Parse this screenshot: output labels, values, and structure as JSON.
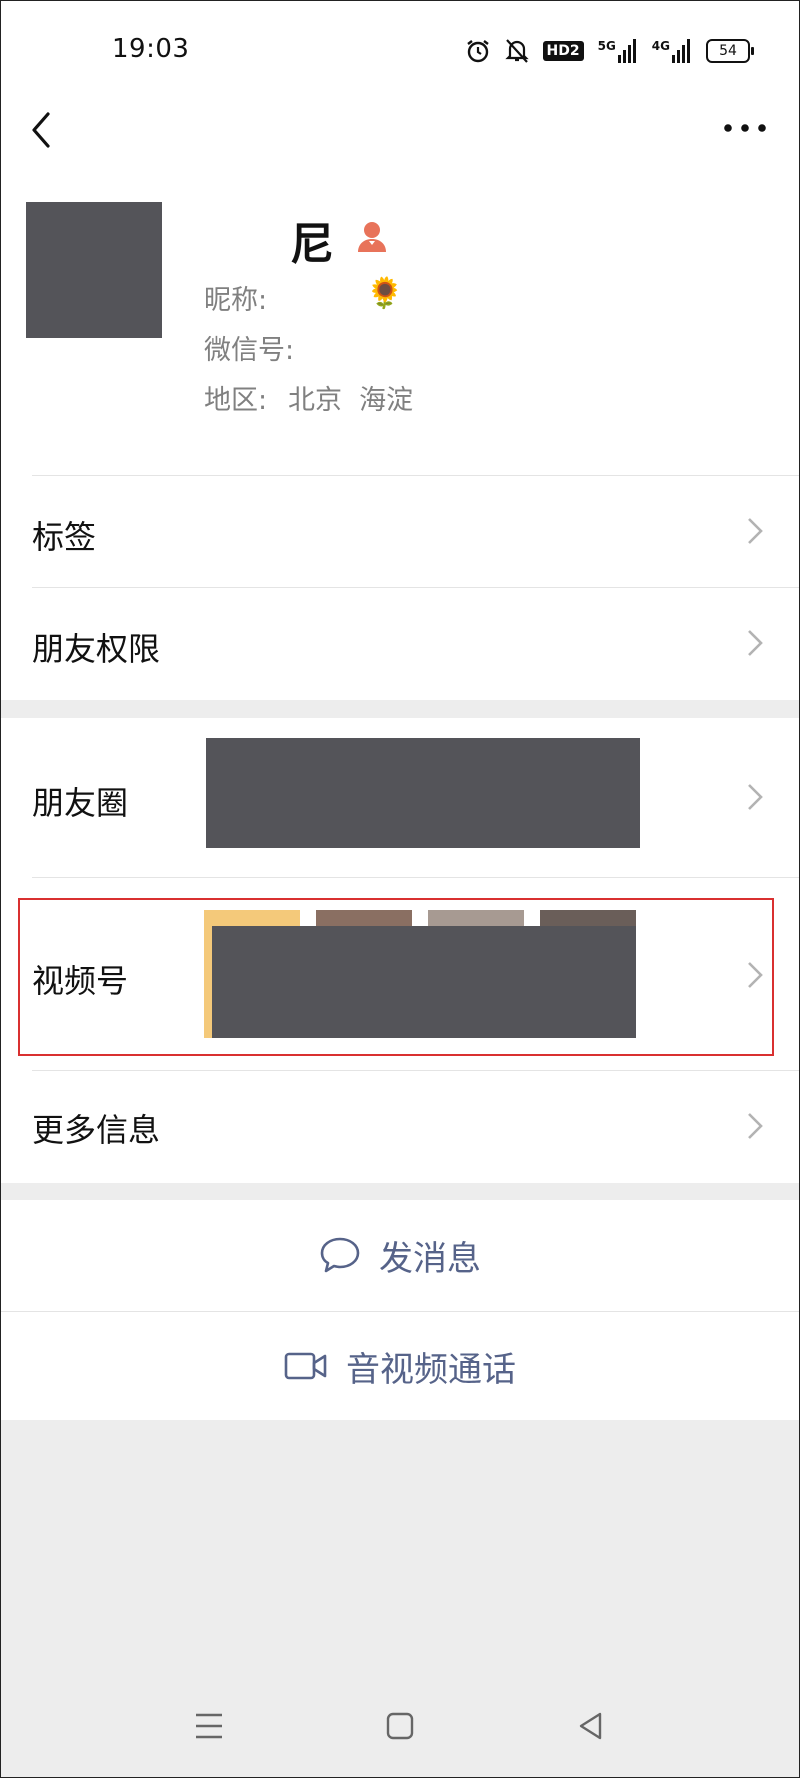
{
  "status_bar": {
    "time": "19:03",
    "hd_label": "HD2",
    "net1": "5G",
    "net2": "4G",
    "battery": "54"
  },
  "profile": {
    "name": "尼",
    "nickname_label": "昵称:",
    "nickname_emoji": "🌻",
    "wechat_id_label": "微信号:",
    "region_label": "地区:",
    "region_value": "北京  海淀"
  },
  "menu": {
    "tags": "标签",
    "permissions": "朋友权限",
    "moments": "朋友圈",
    "channels": "视频号",
    "more_info": "更多信息"
  },
  "actions": {
    "message": "发消息",
    "call": "音视频通话"
  },
  "colors": {
    "action_text": "#566389",
    "highlight_border": "#d93030",
    "badge": "#e8735a"
  }
}
